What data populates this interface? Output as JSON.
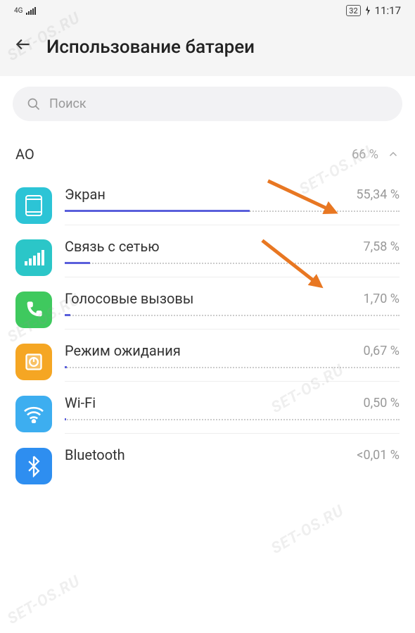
{
  "status_bar": {
    "network_label": "4G",
    "battery_percent": "32",
    "time": "11:17"
  },
  "header": {
    "title": "Использование батареи"
  },
  "search": {
    "placeholder": "Поиск"
  },
  "section": {
    "label": "АО",
    "percent": "66 %"
  },
  "items": [
    {
      "label": "Экран",
      "value": "55,34 %",
      "progress": 55.34,
      "icon": "screen"
    },
    {
      "label": "Связь с сетью",
      "value": "7,58 %",
      "progress": 7.58,
      "icon": "signal"
    },
    {
      "label": "Голосовые вызовы",
      "value": "1,70 %",
      "progress": 1.7,
      "icon": "phone"
    },
    {
      "label": "Режим ожидания",
      "value": "0,67 %",
      "progress": 0.67,
      "icon": "standby"
    },
    {
      "label": "Wi-Fi",
      "value": "0,50 %",
      "progress": 0.5,
      "icon": "wifi"
    },
    {
      "label": "Bluetooth",
      "value": "<0,01 %",
      "progress": 0.01,
      "icon": "bluetooth"
    }
  ],
  "watermark": "SET-OS.RU"
}
